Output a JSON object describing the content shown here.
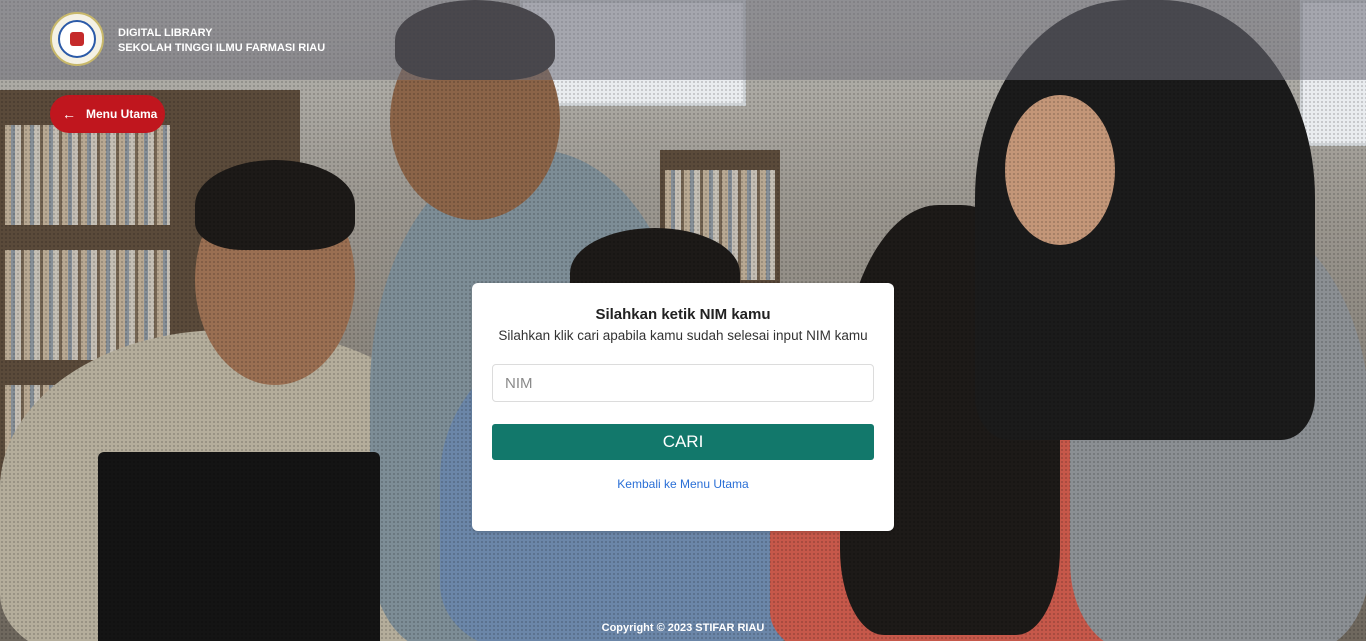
{
  "header": {
    "brand_line1": "DIGITAL LIBRARY",
    "brand_line2": "SEKOLAH TINGGI ILMU FARMASI RIAU",
    "logo_icon": "college-seal-logo"
  },
  "nav": {
    "menu_button_label": "Menu Utama",
    "menu_button_icon": "arrow-left-icon",
    "accent_color": "#c0161e"
  },
  "form": {
    "title": "Silahkan ketik NIM kamu",
    "subtitle": "Silahkan klik cari apabila kamu sudah selesai input NIM kamu",
    "nim_placeholder": "NIM",
    "nim_value": "",
    "search_label": "CARI",
    "search_color": "#12786b",
    "back_link": "Kembali ke Menu Utama"
  },
  "footer": {
    "copyright": "Copyright © 2023 STIFAR RIAU"
  }
}
